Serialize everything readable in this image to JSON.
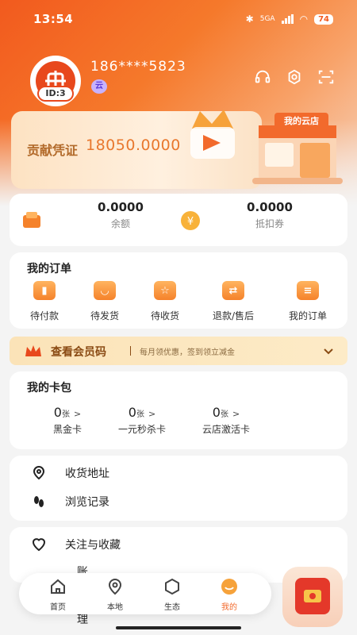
{
  "status_bar": {
    "time": "13:54",
    "network": "5GA",
    "battery": "74"
  },
  "profile": {
    "phone": "186****5823",
    "id_badge": "ID:3",
    "level_badge": "云"
  },
  "contribution": {
    "label": "贡献凭证",
    "value": "18050.0000"
  },
  "store": {
    "sign": "我的云店"
  },
  "balances": [
    {
      "value": "0.0000",
      "label": "余额"
    },
    {
      "value": "0.0000",
      "label": "抵扣券"
    }
  ],
  "orders": {
    "title": "我的订单",
    "items": [
      {
        "label": "待付款"
      },
      {
        "label": "待发货"
      },
      {
        "label": "待收货"
      },
      {
        "label": "退款/售后"
      },
      {
        "label": "我的订单"
      }
    ]
  },
  "member": {
    "title": "查看会员码",
    "desc": "每月领优惠，签到领立减金"
  },
  "wallet": {
    "title": "我的卡包",
    "unit": "张",
    "items": [
      {
        "count": "0",
        "label": "黑金卡"
      },
      {
        "count": "0",
        "label": "一元秒杀卡"
      },
      {
        "count": "0",
        "label": "云店激活卡"
      }
    ]
  },
  "list1": [
    {
      "label": "收货地址"
    },
    {
      "label": "浏览记录"
    }
  ],
  "list2": [
    {
      "label": "关注与收藏"
    },
    {
      "label": "账单管理"
    }
  ],
  "nav": [
    {
      "label": "首页"
    },
    {
      "label": "本地"
    },
    {
      "label": "生态"
    },
    {
      "label": "我的"
    }
  ],
  "colors": {
    "brand": "#f26a2c",
    "member_bg": "#fbe3b8"
  }
}
